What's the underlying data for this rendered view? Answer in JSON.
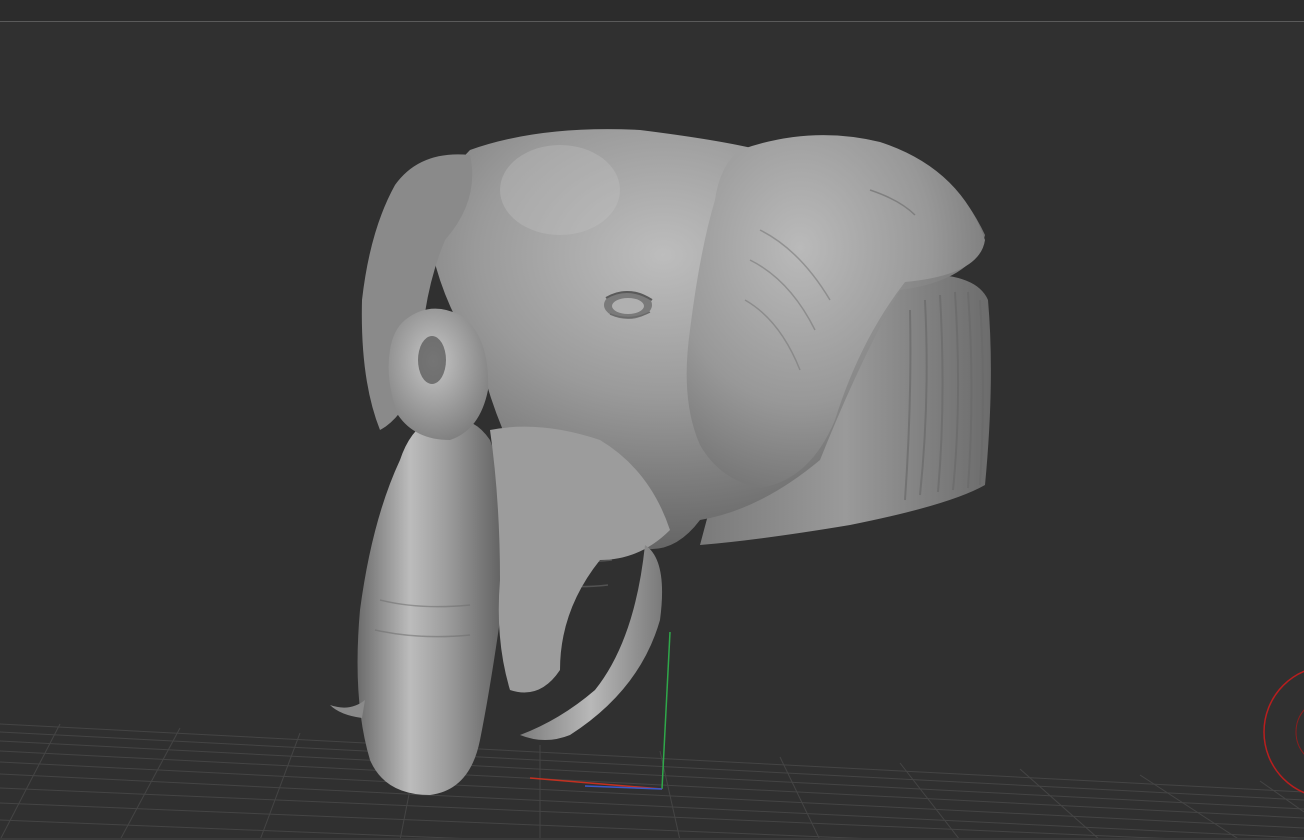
{
  "viewport": {
    "colors": {
      "background": "#303030",
      "top_strip": "#2c2c2c",
      "top_rule": "#5a5a5a",
      "grid_line": "#4a4a4a",
      "mesh_base": "#8e8e8e",
      "axis_x": "#c43020",
      "axis_y": "#2fa84a",
      "axis_z": "#3a58c8",
      "rotation_gizmo": "#b81e1e"
    },
    "model": {
      "subject": "elephant-head",
      "material": "matte-grey-clay"
    },
    "icons": {
      "navigation_gizmo": "rotation-gizmo-icon",
      "axis_indicator": "axis-triad-icon"
    }
  }
}
